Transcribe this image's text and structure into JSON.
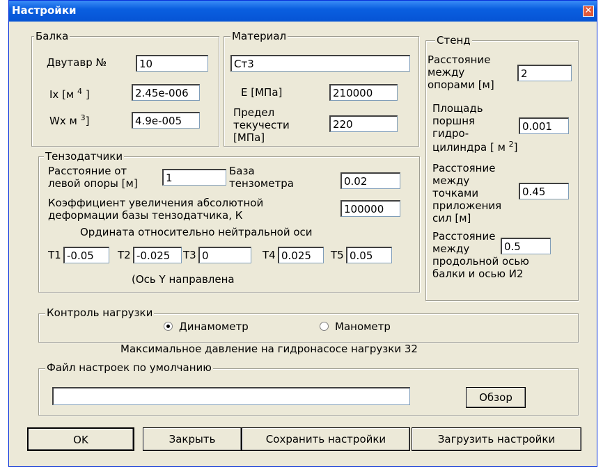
{
  "window": {
    "title": "Настройки",
    "close_glyph": "✕"
  },
  "balka": {
    "legend": "Балка",
    "dvutavr_label": "Двутавр №",
    "dvutavr_value": "10",
    "ix_label": "Ix [м",
    "ix_sup": "4",
    "ix_close": "]",
    "ix_value": "2.45e-006",
    "wx_label": "Wx м",
    "wx_sup": "3",
    "wx_close": "]",
    "wx_value": "4.9e-005"
  },
  "material": {
    "legend": "Материал",
    "name_value": "Ст3",
    "e_label": "E [МПа]",
    "e_value": "210000",
    "limit_label_1": "Предел",
    "limit_label_2": "текучести",
    "limit_label_3": "[МПа]",
    "limit_value": "220"
  },
  "stend": {
    "legend": "Стенд",
    "dist_supports_1": "Расстояние",
    "dist_supports_2": "между",
    "dist_supports_3": "опорами [м]",
    "dist_supports_value": "2",
    "area_1": "Площадь",
    "area_2": "поршня",
    "area_3": "гидро-",
    "area_4": "цилиндра [ м",
    "area_sup": "2",
    "area_close": "]",
    "area_value": "0.001",
    "dist_forces_1": "Расстояние",
    "dist_forces_2": "между",
    "dist_forces_3": "точками",
    "dist_forces_4": "приложения",
    "dist_forces_5": "сил [м]",
    "dist_forces_value": "0.45",
    "dist_axis_1": "Расстояние",
    "dist_axis_2": "между",
    "dist_axis_3": "продольной осью",
    "dist_axis_4": "балки и осью И2",
    "dist_axis_value": "0.5"
  },
  "tenzo": {
    "legend": "Тензодатчики",
    "dist_left_1": "Расстояние от",
    "dist_left_2": "левой опоры [м]",
    "dist_left_value": "1",
    "base_1": "База",
    "base_2": "тензометра",
    "base_value": "0.02",
    "coef_1": "Коэффициент увеличения абсолютной",
    "coef_2": "деформации базы тензодатчика, К",
    "coef_value": "100000",
    "ordinate_label": "Ордината относительно нейтральной оси",
    "t1_label": "T1",
    "t1_value": "-0.05",
    "t2_label": "T2",
    "t2_value": "-0.025",
    "t3_label": "T3",
    "t3_value": "0",
    "t4_label": "T4",
    "t4_value": "0.025",
    "t5_label": "T5",
    "t5_value": "0.05",
    "axis_note": "(Ось  Y направлена"
  },
  "load": {
    "legend": "Контроль нагрузки",
    "opt_dyn": "Динамометр",
    "opt_man": "Манометр",
    "selected": "Динамометр",
    "max_pressure": "Максимальное давление на гидронасосе нагрузки 32"
  },
  "defaults": {
    "legend": "Файл настроек по умолчанию",
    "path_value": "",
    "browse_label": "Обзор"
  },
  "buttons": {
    "ok": "OK",
    "close": "Закрыть",
    "save": "Сохранить настройки",
    "load": "Загрузить настройки"
  }
}
